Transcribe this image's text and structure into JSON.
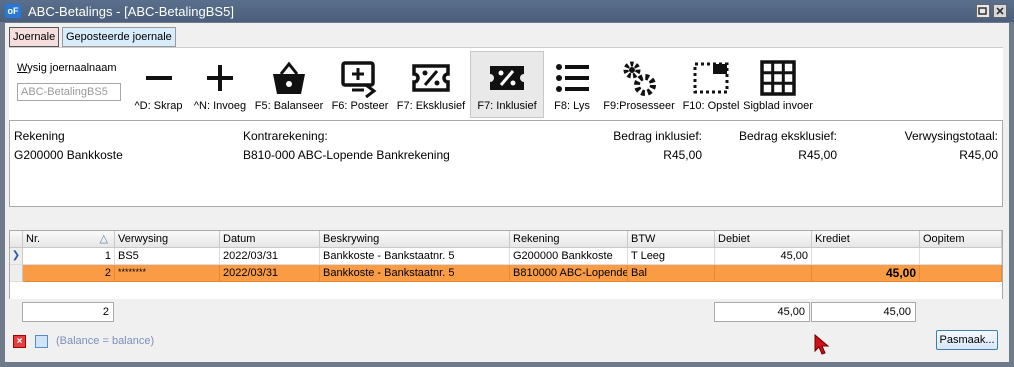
{
  "window": {
    "title": "ABC-Betalings - [ABC-BetalingBS5]",
    "app_icon": "oF"
  },
  "tabs": [
    {
      "label": "Joernale"
    },
    {
      "label": "Geposteerde joernale"
    }
  ],
  "journal": {
    "label": "Wysig joernaalnaam",
    "value": "ABC-BetalingBS5"
  },
  "toolbar": {
    "buttons": [
      {
        "icon": "minus-icon",
        "label": "^D: Skrap"
      },
      {
        "icon": "plus-icon",
        "label": "^N: Invoeg"
      },
      {
        "icon": "basket-icon",
        "label": "F5: Balanseer"
      },
      {
        "icon": "monitor-post-icon",
        "label": "F6: Posteer"
      },
      {
        "icon": "percent-ticket-icon",
        "label": "F7: Eksklusief"
      },
      {
        "icon": "percent-ticket-filled-icon",
        "label": "F7: Inklusief"
      },
      {
        "icon": "list-icon",
        "label": "F8: Lys"
      },
      {
        "icon": "gears-icon",
        "label": "F9:Prosesseer"
      },
      {
        "icon": "layout-icon",
        "label": "F10: Opstel"
      },
      {
        "icon": "grid-icon",
        "label": "Sigblad invoer"
      }
    ]
  },
  "info": {
    "rekening_label": "Rekening",
    "rekening_value": "G200000 Bankkoste",
    "kontra_label": "Kontrarekening:",
    "kontra_value": "B810-000 ABC-Lopende Bankrekening",
    "inklusief_label": "Bedrag inklusief:",
    "inklusief_value": "R45,00",
    "eksklusief_label": "Bedrag eksklusief:",
    "eksklusief_value": "R45,00",
    "totaal_label": "Verwysingstotaal:",
    "totaal_value": "R45,00"
  },
  "grid": {
    "columns": [
      "Nr.",
      "Verwysing",
      "Datum",
      "Beskrywing",
      "Rekening",
      "BTW",
      "Debiet",
      "Krediet",
      "Oopitem"
    ],
    "sort_indicator": "△",
    "rows": [
      {
        "nr": "1",
        "verwysing": "BS5",
        "datum": "2022/03/31",
        "beskrywing": "Bankkoste - Bankstaatnr. 5",
        "rekening": "G200000 Bankkoste",
        "btw": "T Leeg",
        "debiet": "45,00",
        "krediet": "",
        "oopitem": ""
      },
      {
        "nr": "2",
        "verwysing": "********",
        "datum": "2022/03/31",
        "beskrywing": "Bankkoste - Bankstaatnr. 5",
        "rekening": "B810000 ABC-Lopende",
        "btw": "Bal",
        "debiet": "",
        "krediet": "45,00",
        "oopitem": ""
      }
    ],
    "footer": {
      "count": "2",
      "debiet_total": "45,00",
      "krediet_total": "45,00"
    }
  },
  "status": {
    "text": "(Balance = balance)"
  },
  "pasmaak": {
    "label": "Pasmaak..."
  },
  "colors": {
    "selected_row": "#f99c45",
    "title_bar": "#4b5f7d",
    "tab_active": "#f7dede",
    "tab_inactive": "#d9ecfb"
  }
}
